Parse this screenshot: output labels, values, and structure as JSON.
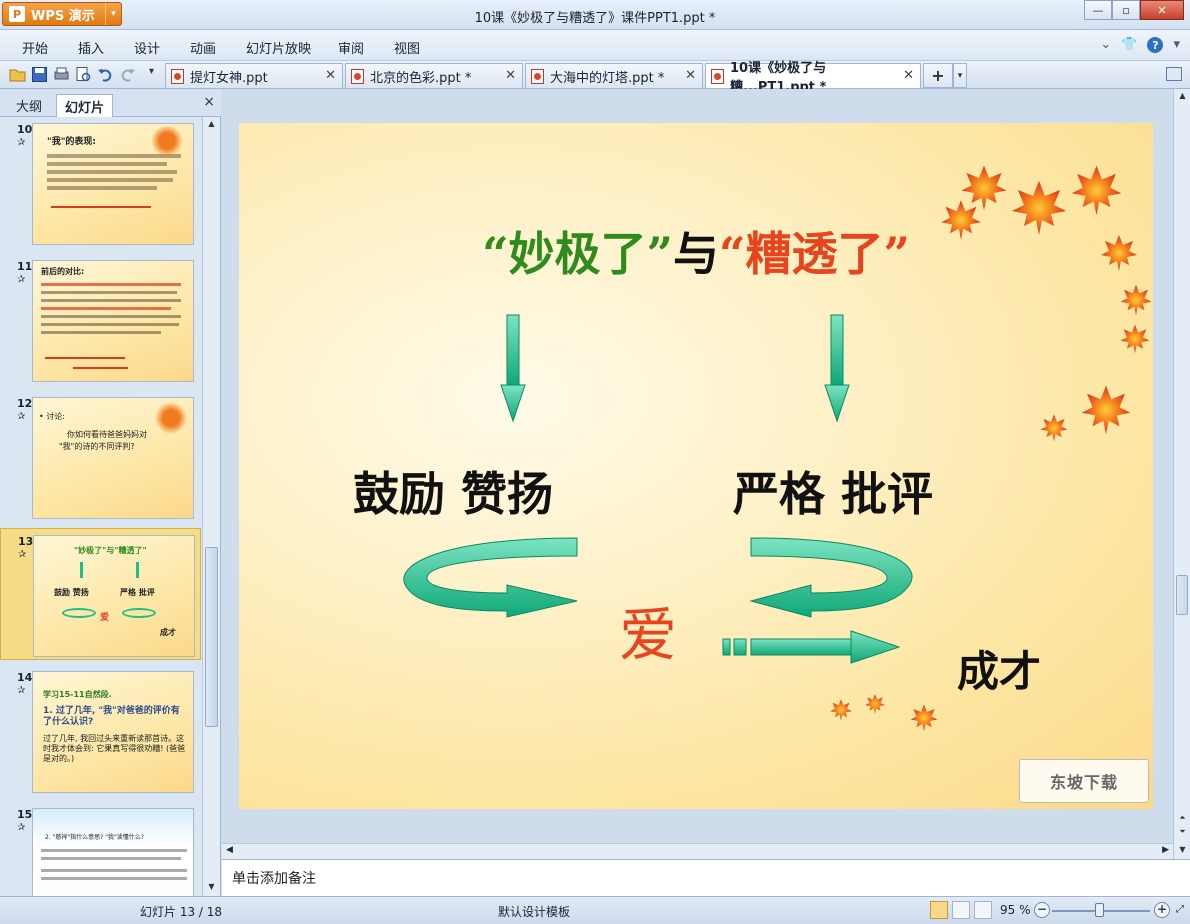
{
  "app": {
    "brand": "WPS 演示",
    "window_title": "10课《妙极了与糟透了》课件PPT1.ppt *"
  },
  "menu": [
    "开始",
    "插入",
    "设计",
    "动画",
    "幻灯片放映",
    "审阅",
    "视图"
  ],
  "tabs": [
    {
      "label": "提灯女神.ppt"
    },
    {
      "label": "北京的色彩.ppt *"
    },
    {
      "label": "大海中的灯塔.ppt *"
    },
    {
      "label": "10课《妙极了与糟...PT1.ppt *"
    }
  ],
  "panel": {
    "tab_outline": "大纲",
    "tab_slides": "幻灯片",
    "close": "×"
  },
  "thumbnails": [
    {
      "num": "10",
      "line1": "\"我\"的表现:"
    },
    {
      "num": "11",
      "line1": "前后的对比:"
    },
    {
      "num": "12",
      "line1": "• 讨论:",
      "line2": "你如何看待爸爸妈妈对",
      "line3": "\"我\"的诗的不同评判?"
    },
    {
      "num": "13",
      "line1": "\"妙极了\"与\"糟透了\"",
      "line2": "鼓励 赞扬",
      "line3": "严格 批评",
      "line4": "爱",
      "line5": "成才"
    },
    {
      "num": "14",
      "line1": "学习15-11自然段.",
      "line2": "1. 过了几年, \"我\"对爸爸的评价有了什么认识?",
      "line3": "过了几年, 我回过头来重新读那首诗。这时我才体会到: 它果真写得很劝糟! (爸爸是对的。)"
    },
    {
      "num": "15",
      "line1": "2. \"慈祥\"指什么意思? \"我\"读懂什么?"
    }
  ],
  "slide": {
    "title_q1": "“妙极了”",
    "title_mid": "与",
    "title_q2": "“糟透了”",
    "left_words": "鼓励  赞扬",
    "right_words": "严格  批评",
    "center": "爱",
    "result": "成才",
    "watermark": "东坡下载"
  },
  "notes_placeholder": "单击添加备注",
  "status": {
    "slide_counter": "幻灯片 13 / 18",
    "template": "默认设计模板",
    "zoom": "95 %"
  },
  "colors": {
    "title_green": "#2e8b1c",
    "title_red": "#e8441e",
    "arrow_teal": "#1dbf8e"
  }
}
